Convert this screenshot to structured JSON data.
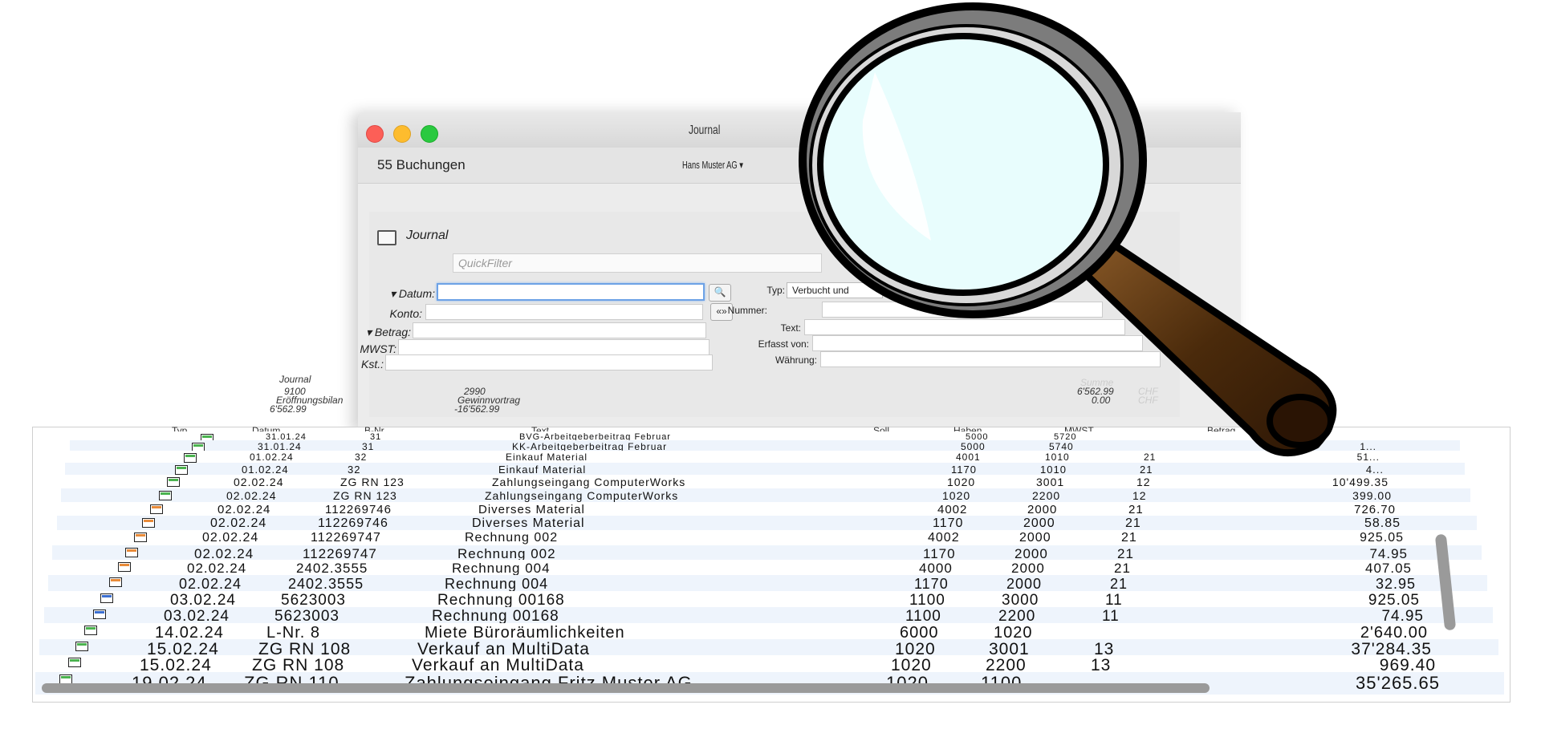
{
  "window": {
    "title": "Journal",
    "booking_count": "55 Buchungen",
    "company": "Hans Muster AG ▾"
  },
  "filter": {
    "section_title": "Journal",
    "quickfilter_placeholder": "QuickFilter",
    "left_labels": {
      "datum": "▾ Datum:",
      "konto": "Konto:",
      "betrag": "▾ Betrag:",
      "mwst": "MWST:",
      "kst": "Kst.:"
    },
    "right_labels": {
      "typ": "Typ:",
      "nummer": "Nummer:",
      "text": "Text:",
      "erfasst_von": "Erfasst von:",
      "waehrung": "Währung:"
    },
    "typ_value": "Verbucht und",
    "search_button": "🔍",
    "range_button": "«»"
  },
  "summary": {
    "heading": "Journal",
    "left": {
      "account": "9100",
      "name": "Eröffnungsbilan",
      "amount": "6'562.99"
    },
    "middle": {
      "account": "2990",
      "name": "Gewinnvortrag",
      "amount": "-16'562.99"
    },
    "sum_label": "Summe",
    "sum1": "6'562.99",
    "sum2": "0.00",
    "currency": "CHF"
  },
  "table": {
    "headers": [
      "Typ",
      "Datum",
      "B-Nr.",
      "Text",
      "Soll",
      "Haben",
      "MWST",
      "Betrag"
    ],
    "rows": [
      {
        "icon": "green",
        "date": "31.01.24",
        "bnr": "31",
        "text": "BVG-Arbeitgeberbeitrag Februar",
        "soll": "5000",
        "haben": "5720",
        "mwst": "",
        "betrag": ""
      },
      {
        "icon": "green",
        "date": "31.01.24",
        "bnr": "31",
        "text": "KK-Arbeitgeberbeitrag Februar",
        "soll": "5000",
        "haben": "5740",
        "mwst": "",
        "betrag": "1..."
      },
      {
        "icon": "green",
        "date": "01.02.24",
        "bnr": "32",
        "text": "Einkauf Material",
        "soll": "4001",
        "haben": "1010",
        "mwst": "21",
        "betrag": "51..."
      },
      {
        "icon": "green",
        "date": "01.02.24",
        "bnr": "32",
        "text": "Einkauf Material",
        "soll": "1170",
        "haben": "1010",
        "mwst": "21",
        "betrag": "4..."
      },
      {
        "icon": "green",
        "date": "02.02.24",
        "bnr": "ZG RN 123",
        "text": "Zahlungseingang ComputerWorks",
        "soll": "1020",
        "haben": "3001",
        "mwst": "12",
        "betrag": "10'499.35"
      },
      {
        "icon": "green",
        "date": "02.02.24",
        "bnr": "ZG RN 123",
        "text": "Zahlungseingang ComputerWorks",
        "soll": "1020",
        "haben": "2200",
        "mwst": "12",
        "betrag": "399.00"
      },
      {
        "icon": "orange",
        "date": "02.02.24",
        "bnr": "112269746",
        "text": "Diverses Material",
        "soll": "4002",
        "haben": "2000",
        "mwst": "21",
        "betrag": "726.70"
      },
      {
        "icon": "orange",
        "date": "02.02.24",
        "bnr": "112269746",
        "text": "Diverses Material",
        "soll": "1170",
        "haben": "2000",
        "mwst": "21",
        "betrag": "58.85"
      },
      {
        "icon": "orange",
        "date": "02.02.24",
        "bnr": "112269747",
        "text": "Rechnung 002",
        "soll": "4002",
        "haben": "2000",
        "mwst": "21",
        "betrag": "925.05"
      },
      {
        "icon": "orange",
        "date": "02.02.24",
        "bnr": "112269747",
        "text": "Rechnung 002",
        "soll": "1170",
        "haben": "2000",
        "mwst": "21",
        "betrag": "74.95"
      },
      {
        "icon": "orange",
        "date": "02.02.24",
        "bnr": "2402.3555",
        "text": "Rechnung 004",
        "soll": "4000",
        "haben": "2000",
        "mwst": "21",
        "betrag": "407.05"
      },
      {
        "icon": "orange",
        "date": "02.02.24",
        "bnr": "2402.3555",
        "text": "Rechnung 004",
        "soll": "1170",
        "haben": "2000",
        "mwst": "21",
        "betrag": "32.95"
      },
      {
        "icon": "blue",
        "date": "03.02.24",
        "bnr": "5623003",
        "text": "Rechnung 00168",
        "soll": "1100",
        "haben": "3000",
        "mwst": "11",
        "betrag": "925.05"
      },
      {
        "icon": "blue",
        "date": "03.02.24",
        "bnr": "5623003",
        "text": "Rechnung 00168",
        "soll": "1100",
        "haben": "2200",
        "mwst": "11",
        "betrag": "74.95"
      },
      {
        "icon": "green",
        "date": "14.02.24",
        "bnr": "L-Nr. 8",
        "text": "Miete Büroräumlichkeiten",
        "soll": "6000",
        "haben": "1020",
        "mwst": "",
        "betrag": "2'640.00"
      },
      {
        "icon": "green",
        "date": "15.02.24",
        "bnr": "ZG RN 108",
        "text": "Verkauf an MultiData",
        "soll": "1020",
        "haben": "3001",
        "mwst": "13",
        "betrag": "37'284.35"
      },
      {
        "icon": "green",
        "date": "15.02.24",
        "bnr": "ZG RN 108",
        "text": "Verkauf an MultiData",
        "soll": "1020",
        "haben": "2200",
        "mwst": "13",
        "betrag": "969.40"
      },
      {
        "icon": "green",
        "date": "19.02.24",
        "bnr": "ZG RN 110",
        "text": "Zahlungseingang Fritz Muster AG",
        "soll": "1020",
        "haben": "1100",
        "mwst": "",
        "betrag": "35'265.65"
      }
    ]
  },
  "colors": {
    "row_alt": "#eef4fc",
    "accent_focus": "#6da2e6",
    "lens": "#e8fdfd",
    "handle": "#4a2a0b"
  },
  "icons": [
    "journal-icon",
    "search-icon",
    "range-icon",
    "magnifier-icon"
  ]
}
